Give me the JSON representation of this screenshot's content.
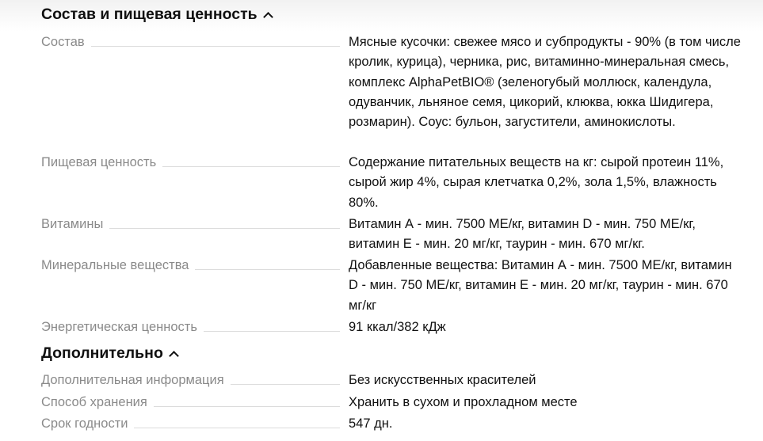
{
  "sections": [
    {
      "title": "Состав и пищевая ценность",
      "rows": [
        {
          "label": "Состав",
          "value": "Мясные кусочки: свежее мясо и субпродукты - 90% (в том числе кролик, курица), черника, рис, витаминно-минеральная смесь, комплекс AlphaPetBIO® (зеленогубый моллюск, календула, одуванчик, льняное семя, цикорий, клюква, юкка Шидигера, розмарин). Соус: бульон, загустители, аминокислоты."
        },
        {
          "label": "Пищевая ценность",
          "value": "Содержание питательных веществ на кг: сырой протеин 11%, сырой жир 4%, сырая клетчатка 0,2%, зола 1,5%, влажность 80%."
        },
        {
          "label": "Витамины",
          "value": "Витамин А - мин. 7500 МЕ/кг, витамин D - мин. 750 МЕ/кг, витамин Е - мин. 20 мг/кг, таурин - мин. 670 мг/кг."
        },
        {
          "label": "Минеральные вещества",
          "value": "Добавленные вещества: Витамин А - мин. 7500 МЕ/кг, витамин D - мин. 750 МЕ/кг, витамин Е - мин. 20 мг/кг, таурин - мин. 670 мг/кг"
        },
        {
          "label": "Энергетическая ценность",
          "value": "91 ккал/382 кДж"
        }
      ]
    },
    {
      "title": "Дополнительно",
      "rows": [
        {
          "label": "Дополнительная информация",
          "value": "Без искусственных красителей"
        },
        {
          "label": "Способ хранения",
          "value": "Хранить в сухом и прохладном месте"
        },
        {
          "label": "Срок годности",
          "value": "547 дн."
        }
      ]
    }
  ]
}
